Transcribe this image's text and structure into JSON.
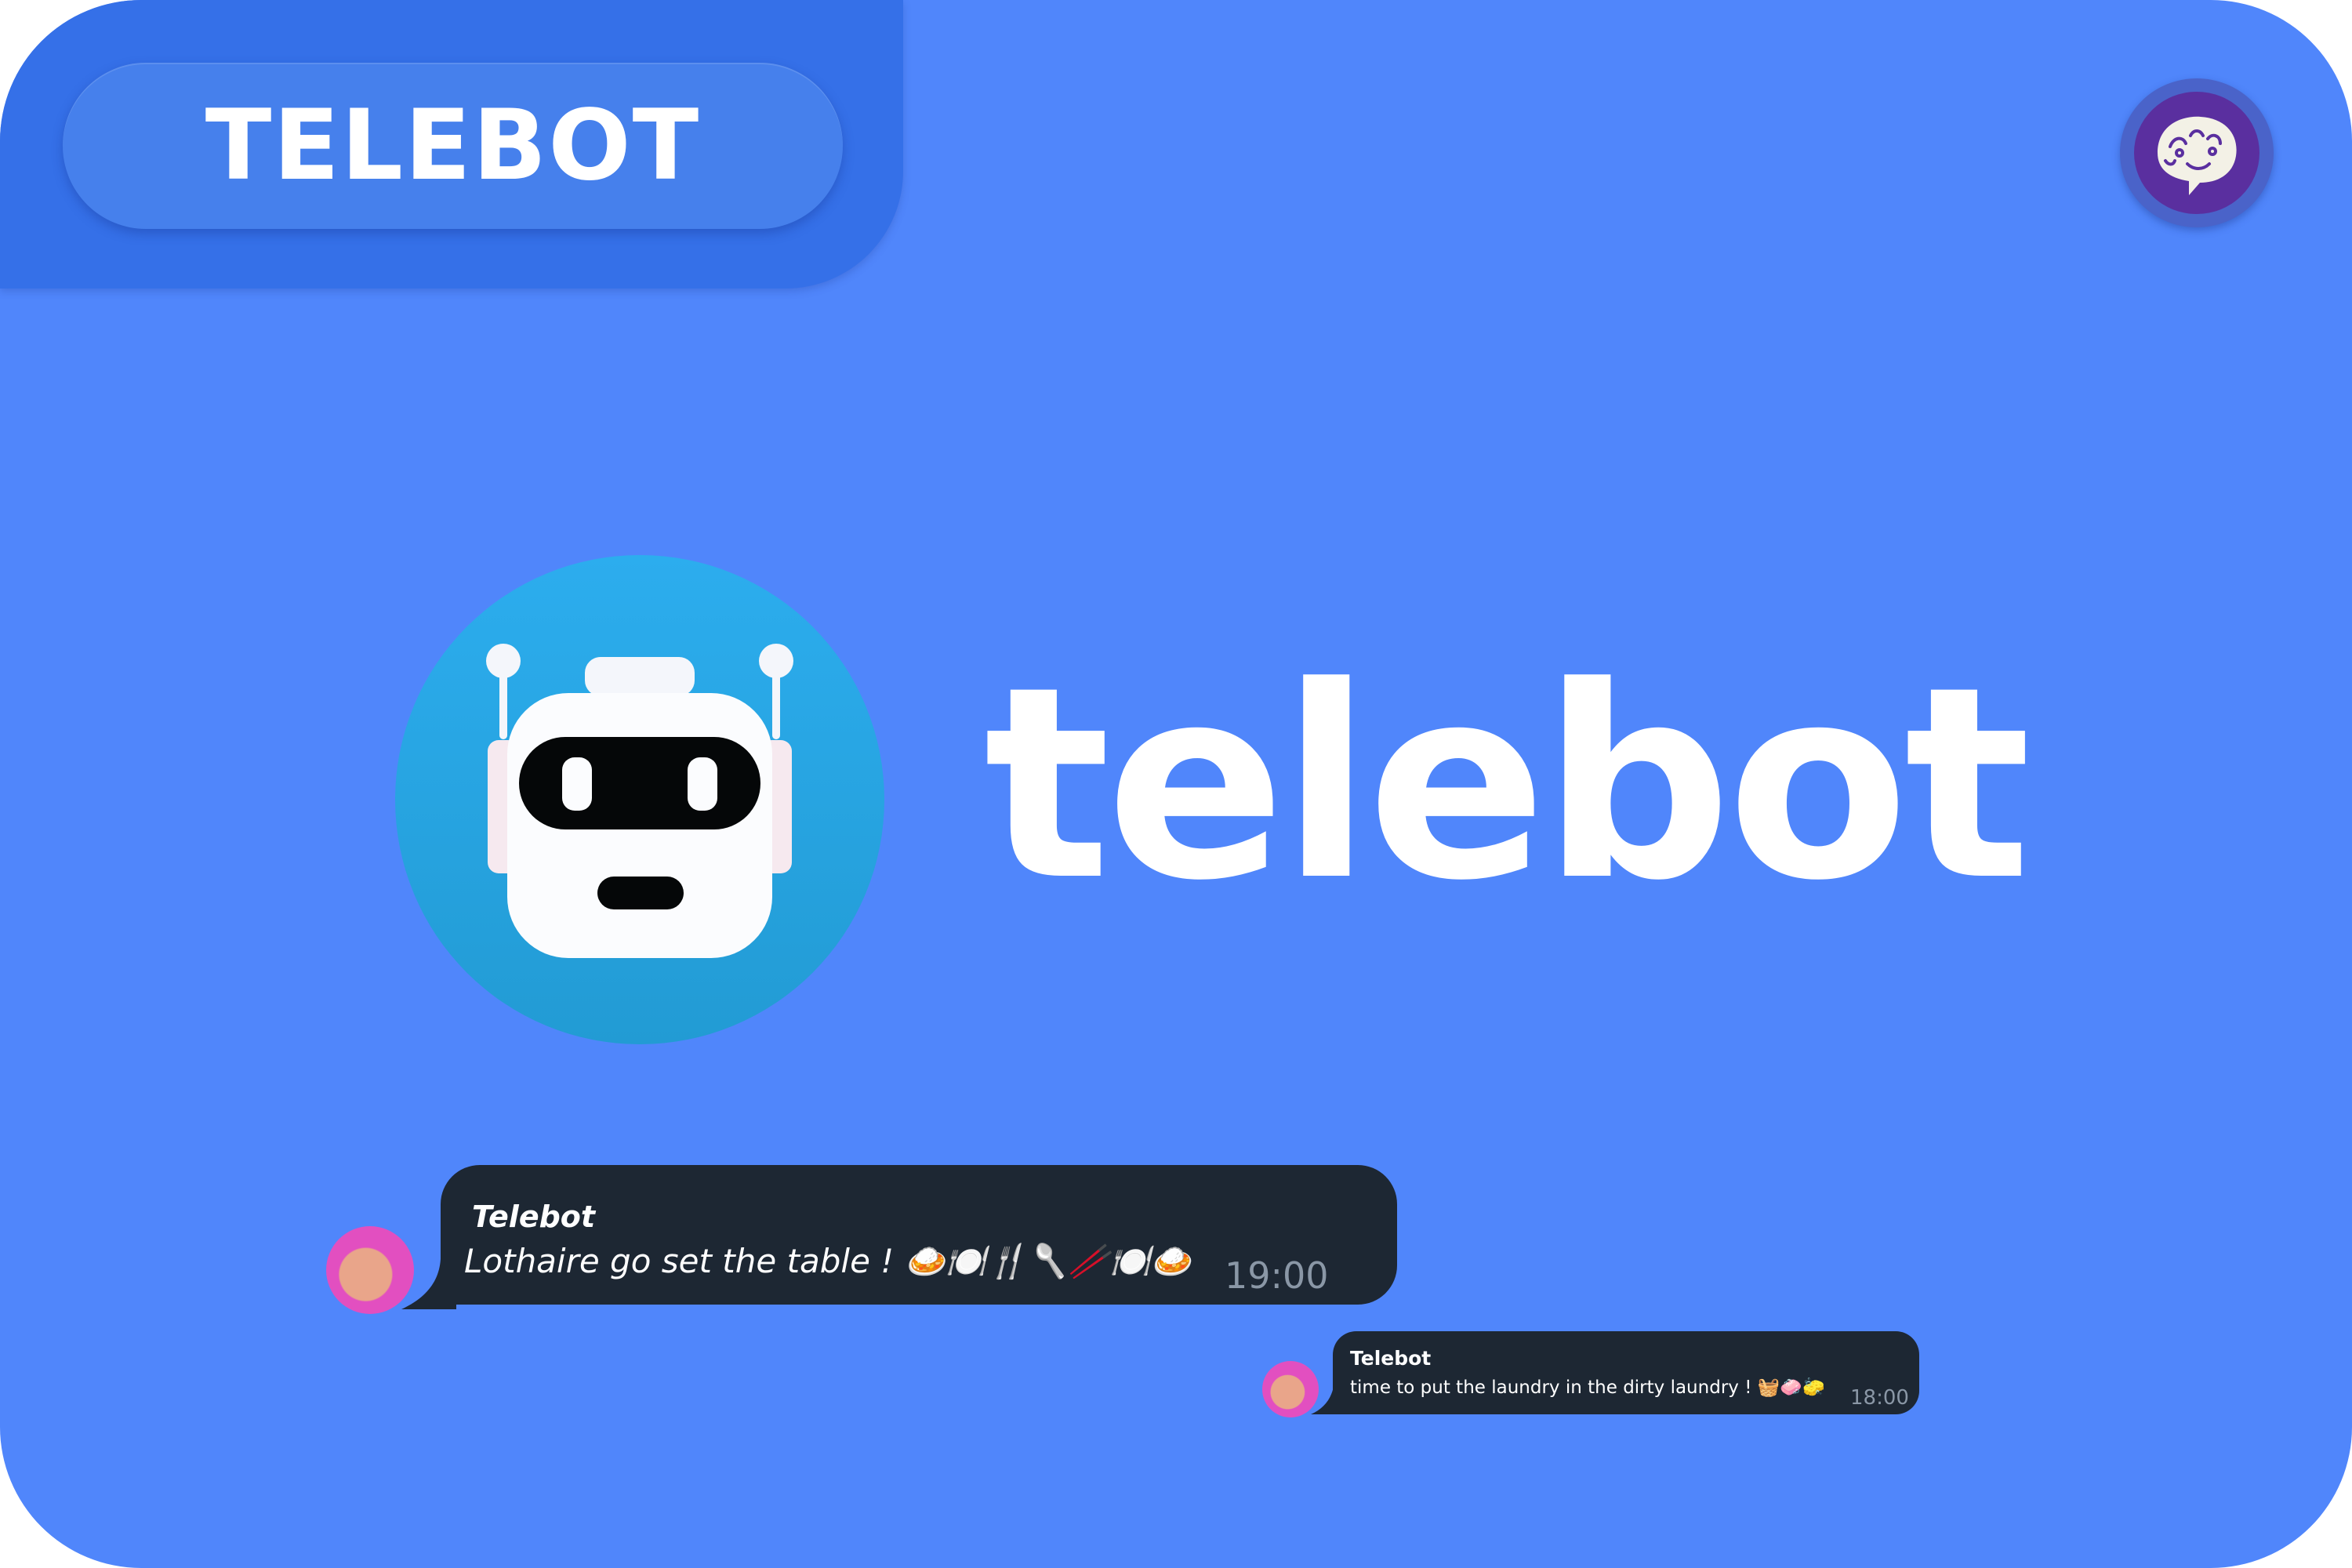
{
  "tab": {
    "title": "TELEBOT"
  },
  "badge": {
    "icon": "doodle-face-icon"
  },
  "logo": {
    "icon": "robot-icon",
    "wordmark": "telebot"
  },
  "messages": [
    {
      "sender": "Telebot",
      "text": "Lothaire go set the table ! 🍛🍽️🍴🥄🥢🍽️🍛",
      "time": "19:00"
    },
    {
      "sender": "Telebot",
      "text": "time to put the laundry in the dirty laundry ! 🧺🧼🧽",
      "time": "18:00"
    }
  ],
  "colors": {
    "background": "#5086fb",
    "tab": "#3570e8",
    "bubble": "#1d2733",
    "robot_circle": "#29a8e6"
  }
}
